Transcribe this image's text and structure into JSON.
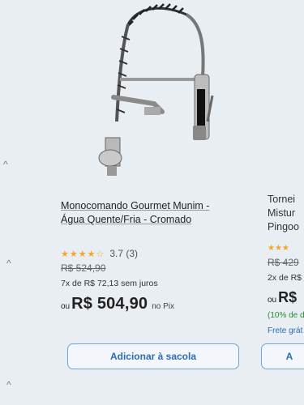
{
  "products": [
    {
      "title_line1": "Monocomando Gourmet Munim -",
      "title_line2": "Água Quente/Fria - Cromado",
      "stars": "★★★★☆",
      "rating": "3.7 (3)",
      "old_price": "R$ 524,90",
      "installments": "7x de R$ 72,13 sem juros",
      "price_prefix": "ou",
      "price": "R$ 504,90",
      "price_suffix": "no Pix",
      "button_label": "Adicionar à sacola"
    },
    {
      "title_line1": "Tornei",
      "title_line2": "Mistur",
      "title_line3": "Pingoo",
      "stars": "★★★",
      "old_price": "R$ 429",
      "installments": "2x de R$",
      "price_prefix": "ou",
      "price": "R$",
      "discount": "(10% de d",
      "shipping": "Frete grát",
      "button_label": "A"
    }
  ],
  "icons": {
    "scroll_up": "^"
  }
}
